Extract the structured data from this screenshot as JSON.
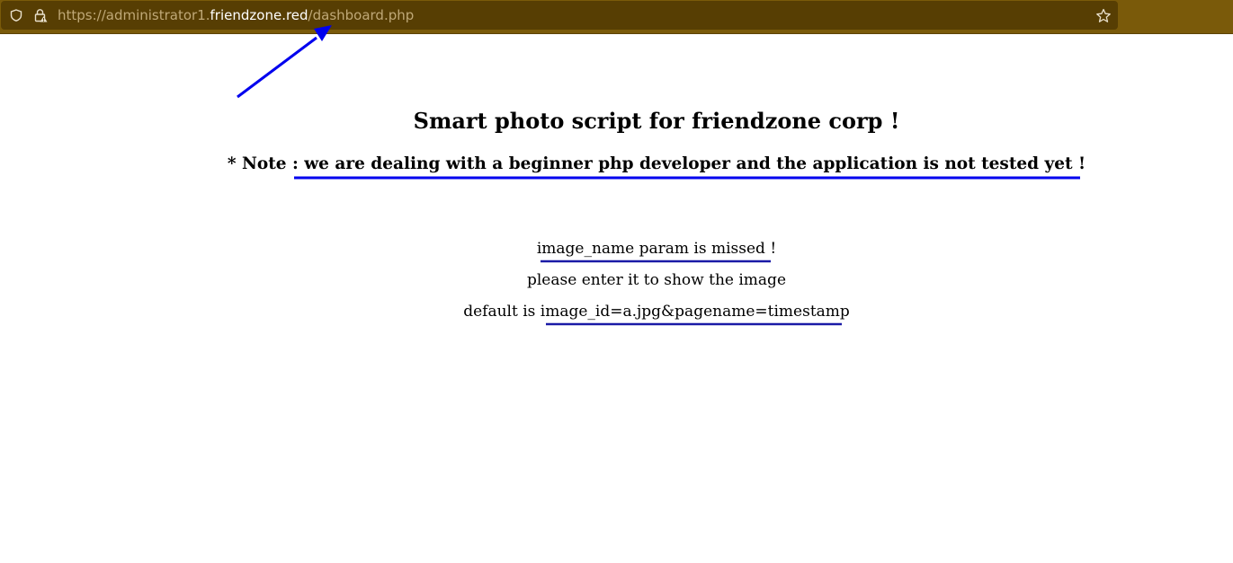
{
  "browser": {
    "url_prefix": "https://administrator1.",
    "url_host": "friendzone.red",
    "url_path": "/dashboard.php",
    "shield_icon": "shield-icon",
    "lock_icon": "lock-warning-icon",
    "bookmark_icon": "star-icon",
    "bar_color": "#7a5a0a"
  },
  "page": {
    "title": "Smart photo script for friendzone corp !",
    "note": "* Note : we are dealing with a beginner php developer and the application is not tested yet !",
    "message_missing": "image_name param is missed !",
    "message_enter": "please enter it to show the image",
    "default_label": "default is ",
    "default_value": "image_id=a.jpg&pagename=timestamp"
  },
  "annotations": {
    "color": "#0000ee"
  }
}
